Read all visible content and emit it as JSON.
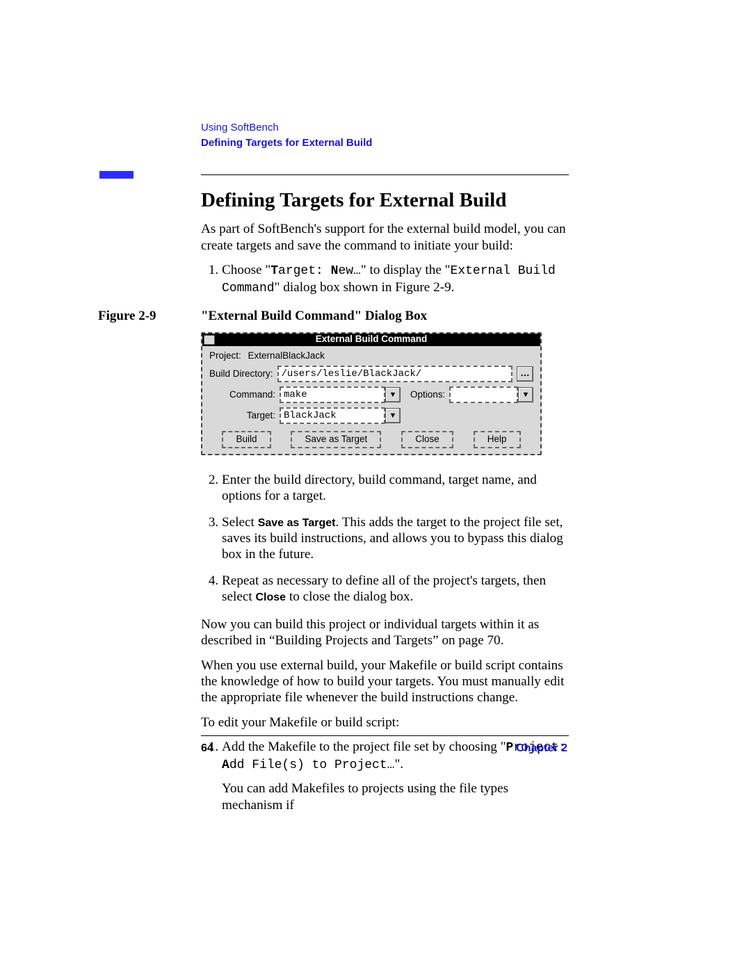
{
  "header": {
    "breadcrumb": "Using SoftBench",
    "section": "Defining Targets for External Build"
  },
  "heading": "Defining Targets for External Build",
  "intro": "As part of SoftBench's support for the external build model, you can create targets and save the command to initiate your build:",
  "steps1": {
    "s1_a": "Choose \"",
    "s1_b_bold": "T",
    "s1_b_rest": "arget: ",
    "s1_c_bold": "N",
    "s1_c_rest": "ew…",
    "s1_d": "\" to display the \"",
    "s1_e_mono": "External Build Command",
    "s1_f": "\" dialog box shown in Figure 2-9."
  },
  "figure": {
    "label": "Figure 2-9",
    "title": "\"External Build Command\" Dialog Box"
  },
  "dialog": {
    "title": "External Build Command",
    "project_label": "Project:",
    "project_value": "ExternalBlackJack",
    "builddir_label": "Build Directory:",
    "builddir_value": "/users/leslie/BlackJack/",
    "command_label": "Command:",
    "command_value": "make",
    "options_label": "Options:",
    "options_value": "",
    "target_label": "Target:",
    "target_value": "BlackJack",
    "buttons": {
      "build": "Build",
      "save": "Save as Target",
      "close": "Close",
      "help": "Help"
    }
  },
  "steps2": {
    "s2": "Enter the build directory, build command, target name, and options for a target.",
    "s3_a": "Select ",
    "s3_b": "Save as Target",
    "s3_c": ". This adds the target to the project file set, saves its build instructions, and allows you to bypass this dialog box in the future.",
    "s4_a": "Repeat as necessary to define all of the project's targets, then select ",
    "s4_b": "Close",
    "s4_c": " to close the dialog box."
  },
  "para_after1": "Now you can build this project or individual targets within it as described in “Building Projects and Targets” on page  70.",
  "para_after2": "When you use external build, your Makefile or build script contains the knowledge of how to build your targets. You must manually edit the appropriate file whenever the build instructions change.",
  "para_after3": "To edit your Makefile or build script:",
  "edit_steps": {
    "e1_a": "Add the Makefile to the project file set by choosing \"",
    "e1_b_bold": "P",
    "e1_b_rest": "roject: ",
    "e1_c_bold": "A",
    "e1_c_rest": "dd File(s) to Project…",
    "e1_d": "\".",
    "e1_follow": "You can add Makefiles to projects using the file types mechanism if"
  },
  "footer": {
    "page": "64",
    "chapter": "Chapter 2"
  }
}
